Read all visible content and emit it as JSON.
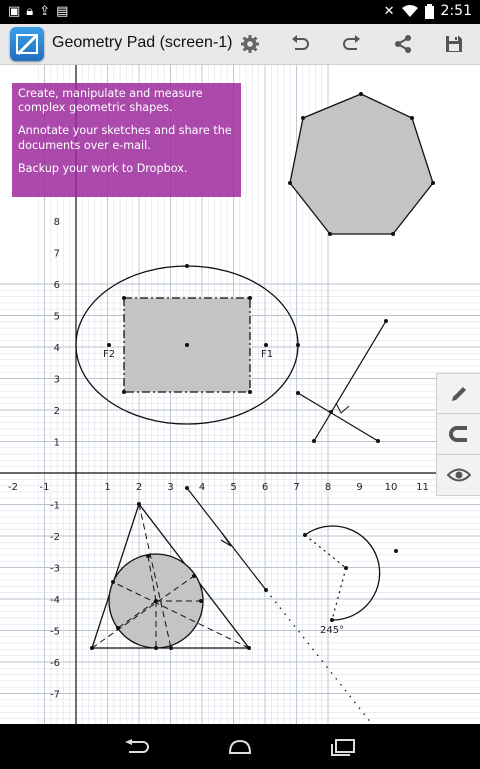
{
  "status_bar": {
    "left_icons": [
      "screenshot-icon",
      "lock-icon",
      "upload-icon",
      "image-icon"
    ],
    "right_icons": [
      "mute-icon",
      "wifi-icon",
      "battery-icon"
    ],
    "time": "2:51"
  },
  "action_bar": {
    "title": "Geometry Pad (screen-1)",
    "actions": [
      "settings-icon",
      "undo-icon",
      "redo-icon",
      "share-icon",
      "save-icon"
    ]
  },
  "info_box": {
    "line1": "Create, manipulate and measure complex geometric shapes.",
    "line2": "Annotate your sketches and share the documents over e-mail.",
    "line3": "Backup your work to Dropbox."
  },
  "axes": {
    "x_ticks": [
      "-2",
      "-1",
      "1",
      "2",
      "3",
      "4",
      "5",
      "6",
      "7",
      "8",
      "9",
      "10",
      "11"
    ],
    "y_ticks_positive": [
      "1",
      "2",
      "3",
      "4",
      "5",
      "6",
      "7",
      "8"
    ],
    "y_ticks_negative": [
      "-1",
      "-2",
      "-3",
      "-4",
      "-5",
      "-6",
      "-7"
    ]
  },
  "shapes": {
    "ellipse_focus_left": "F2",
    "ellipse_focus_right": "F1",
    "arc_angle": "245°"
  },
  "side_tools": [
    "pencil-icon",
    "magnet-icon",
    "eye-icon"
  ],
  "nav_bar": [
    "back-icon",
    "home-icon",
    "recent-apps-icon"
  ]
}
